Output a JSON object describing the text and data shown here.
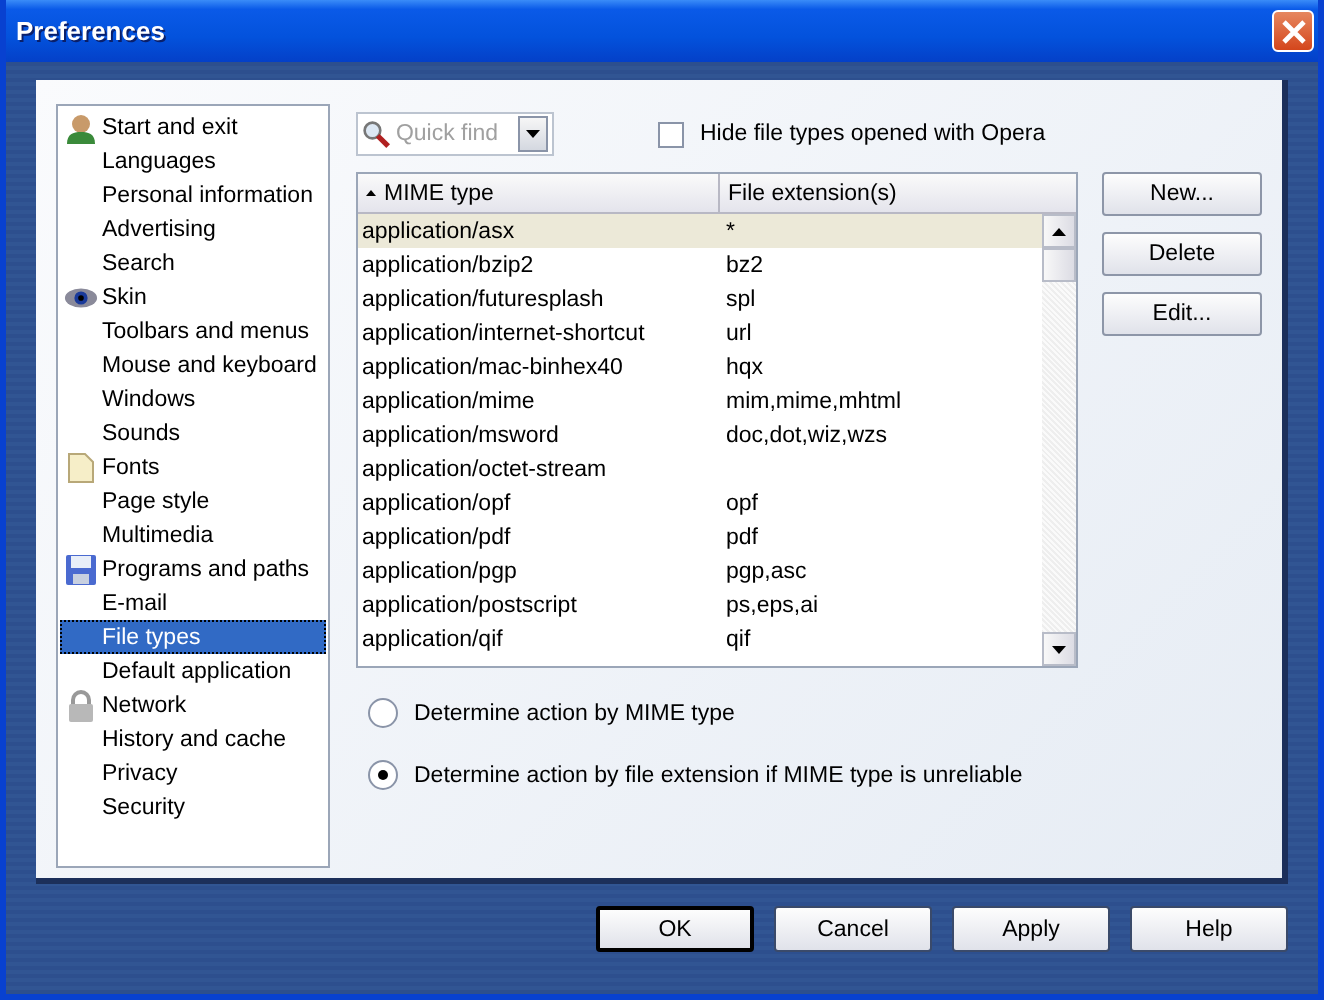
{
  "window": {
    "title": "Preferences"
  },
  "sidebar": {
    "items": [
      {
        "label": "Start and exit",
        "kind": "section",
        "selected": false
      },
      {
        "label": "Languages",
        "kind": "page",
        "selected": false
      },
      {
        "label": "Personal information",
        "kind": "page",
        "selected": false
      },
      {
        "label": "Advertising",
        "kind": "page",
        "selected": false
      },
      {
        "label": "Search",
        "kind": "page",
        "selected": false
      },
      {
        "label": "Skin",
        "kind": "section",
        "selected": false
      },
      {
        "label": "Toolbars and menus",
        "kind": "page",
        "selected": false
      },
      {
        "label": "Mouse and keyboard",
        "kind": "page",
        "selected": false
      },
      {
        "label": "Windows",
        "kind": "page",
        "selected": false
      },
      {
        "label": "Sounds",
        "kind": "page",
        "selected": false
      },
      {
        "label": "Fonts",
        "kind": "section",
        "selected": false
      },
      {
        "label": "Page style",
        "kind": "page",
        "selected": false
      },
      {
        "label": "Multimedia",
        "kind": "page",
        "selected": false
      },
      {
        "label": "Programs and paths",
        "kind": "section",
        "selected": false
      },
      {
        "label": "E-mail",
        "kind": "page",
        "selected": false
      },
      {
        "label": "File types",
        "kind": "page",
        "selected": true
      },
      {
        "label": "Default application",
        "kind": "page",
        "selected": false
      },
      {
        "label": "Network",
        "kind": "section",
        "selected": false
      },
      {
        "label": "History and cache",
        "kind": "page",
        "selected": false
      },
      {
        "label": "Privacy",
        "kind": "page",
        "selected": false
      },
      {
        "label": "Security",
        "kind": "page",
        "selected": false
      }
    ]
  },
  "quick_find": {
    "placeholder": "Quick find"
  },
  "hide_opera": {
    "label": "Hide file types opened with Opera",
    "checked": false
  },
  "table": {
    "columns": [
      "MIME type",
      "File extension(s)"
    ],
    "rows": [
      {
        "cells": [
          "application/asx",
          "*"
        ],
        "selected": true
      },
      {
        "cells": [
          "application/bzip2",
          "bz2"
        ],
        "selected": false
      },
      {
        "cells": [
          "application/futuresplash",
          "spl"
        ],
        "selected": false
      },
      {
        "cells": [
          "application/internet-shortcut",
          "url"
        ],
        "selected": false
      },
      {
        "cells": [
          "application/mac-binhex40",
          "hqx"
        ],
        "selected": false
      },
      {
        "cells": [
          "application/mime",
          "mim,mime,mhtml"
        ],
        "selected": false
      },
      {
        "cells": [
          "application/msword",
          "doc,dot,wiz,wzs"
        ],
        "selected": false
      },
      {
        "cells": [
          "application/octet-stream",
          ""
        ],
        "selected": false
      },
      {
        "cells": [
          "application/opf",
          "opf"
        ],
        "selected": false
      },
      {
        "cells": [
          "application/pdf",
          "pdf"
        ],
        "selected": false
      },
      {
        "cells": [
          "application/pgp",
          "pgp,asc"
        ],
        "selected": false
      },
      {
        "cells": [
          "application/postscript",
          "ps,eps,ai"
        ],
        "selected": false
      },
      {
        "cells": [
          "application/qif",
          "qif"
        ],
        "selected": false
      }
    ]
  },
  "side_buttons": [
    "New...",
    "Delete",
    "Edit..."
  ],
  "radios": [
    {
      "label": "Determine action by MIME type",
      "selected": false
    },
    {
      "label": "Determine action by file extension if MIME type is unreliable",
      "selected": true
    }
  ],
  "buttons": [
    {
      "label": "OK",
      "default": true
    },
    {
      "label": "Cancel",
      "default": false
    },
    {
      "label": "Apply",
      "default": false
    },
    {
      "label": "Help",
      "default": false
    }
  ]
}
